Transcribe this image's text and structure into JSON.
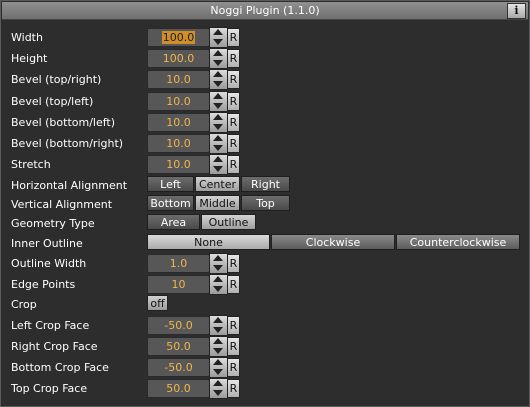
{
  "window": {
    "title": "Noggi Plugin (1.1.0)",
    "info_label": "i"
  },
  "reset_label": "R",
  "params": {
    "width": {
      "label": "Width",
      "value": "100.0"
    },
    "height": {
      "label": "Height",
      "value": "100.0"
    },
    "bevel_top_right": {
      "label": "Bevel (top/right)",
      "value": "10.0"
    },
    "bevel_top_left": {
      "label": "Bevel (top/left)",
      "value": "10.0"
    },
    "bevel_bottom_left": {
      "label": "Bevel (bottom/left)",
      "value": "10.0"
    },
    "bevel_bottom_right": {
      "label": "Bevel (bottom/right)",
      "value": "10.0"
    },
    "stretch": {
      "label": "Stretch",
      "value": "10.0"
    },
    "outline_width": {
      "label": "Outline Width",
      "value": "1.0"
    },
    "edge_points": {
      "label": "Edge Points",
      "value": "10"
    },
    "left_crop_face": {
      "label": "Left Crop Face",
      "value": "-50.0"
    },
    "right_crop_face": {
      "label": "Right Crop Face",
      "value": "50.0"
    },
    "bottom_crop_face": {
      "label": "Bottom Crop Face",
      "value": "-50.0"
    },
    "top_crop_face": {
      "label": "Top Crop Face",
      "value": "50.0"
    }
  },
  "horizontal_alignment": {
    "label": "Horizontal Alignment",
    "options": [
      "Left",
      "Center",
      "Right"
    ],
    "selected": "Center"
  },
  "vertical_alignment": {
    "label": "Vertical Alignment",
    "options": [
      "Bottom",
      "Middle",
      "Top"
    ],
    "selected": "Middle"
  },
  "geometry_type": {
    "label": "Geometry Type",
    "options": [
      "Area",
      "Outline"
    ],
    "selected": "Outline"
  },
  "inner_outline": {
    "label": "Inner Outline",
    "options": [
      "None",
      "Clockwise",
      "Counterclockwise"
    ],
    "selected": "None"
  },
  "crop": {
    "label": "Crop",
    "value": "off"
  }
}
